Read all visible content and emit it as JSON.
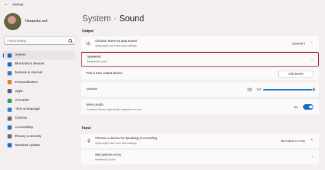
{
  "window": {
    "title": "Settings"
  },
  "user": {
    "name": "himanshu anil"
  },
  "search": {
    "placeholder": "Find a setting"
  },
  "nav": [
    {
      "label": "System",
      "icon": "monitor-icon",
      "color": "#1a6fc4",
      "active": true
    },
    {
      "label": "Bluetooth & devices",
      "icon": "bluetooth-icon",
      "color": "#1a6fc4"
    },
    {
      "label": "Network & internet",
      "icon": "wifi-icon",
      "color": "#3b78c4"
    },
    {
      "label": "Personalization",
      "icon": "brush-icon",
      "color": "#d9822b"
    },
    {
      "label": "Apps",
      "icon": "apps-icon",
      "color": "#5c5c7a"
    },
    {
      "label": "Accounts",
      "icon": "person-icon",
      "color": "#2e9e5b"
    },
    {
      "label": "Time & language",
      "icon": "globe-icon",
      "color": "#2a7fd4"
    },
    {
      "label": "Gaming",
      "icon": "gamepad-icon",
      "color": "#6b6b6b"
    },
    {
      "label": "Accessibility",
      "icon": "accessibility-icon",
      "color": "#2a6fc9"
    },
    {
      "label": "Privacy & security",
      "icon": "shield-icon",
      "color": "#6b6b6b"
    },
    {
      "label": "Windows Update",
      "icon": "update-icon",
      "color": "#1a6fc4"
    }
  ],
  "header": {
    "crumb": "System",
    "separator": "›",
    "title": "Sound"
  },
  "output": {
    "label": "Output",
    "choose_title": "Choose where to play sound",
    "choose_sub": "Apps might have their own settings",
    "choose_value": "Speakers",
    "speakers_title": "Speakers",
    "speakers_sub": "Realtek(R) Audio",
    "pair_label": "Pair a new output device",
    "add_device": "Add device",
    "volume_label": "Volume",
    "volume_value": "100",
    "volume_level": 1.0,
    "mono_title": "Mono audio",
    "mono_sub": "Combine left and right audio channels into one",
    "mono_state": "On"
  },
  "input": {
    "label": "Input",
    "choose_title": "Choose a device for speaking or recording",
    "choose_sub": "Apps might have their own settings",
    "choose_value": "Microphone Array",
    "mic_title": "Microphone Array",
    "mic_sub": "Realtek(R) Audio"
  },
  "colors": {
    "accent": "#1a6fc4",
    "highlight": "#a52a2a"
  }
}
